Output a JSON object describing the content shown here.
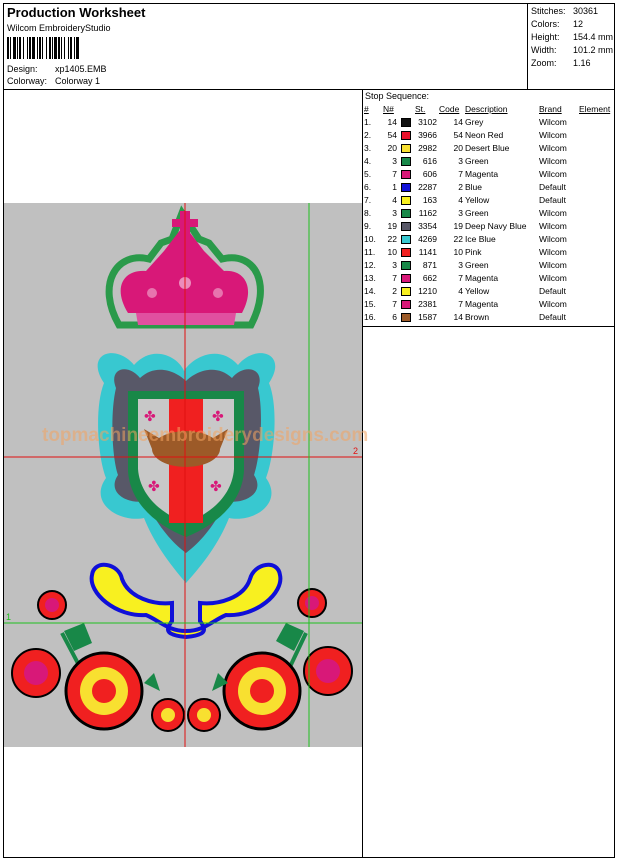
{
  "header": {
    "title": "Production Worksheet",
    "software": "Wilcom EmbroideryStudio",
    "design_label": "Design:",
    "design_value": "xp1405.EMB",
    "colorway_label": "Colorway:",
    "colorway_value": "Colorway 1"
  },
  "stats": {
    "stitches_label": "Stitches:",
    "stitches_value": "30361",
    "colors_label": "Colors:",
    "colors_value": "12",
    "height_label": "Height:",
    "height_value": "154.4 mm",
    "width_label": "Width:",
    "width_value": "101.2 mm",
    "zoom_label": "Zoom:",
    "zoom_value": "1.16"
  },
  "preview": {
    "watermark": "topmachineembroiderydesigns.com",
    "marker_1": "1",
    "marker_2": "2"
  },
  "sequence": {
    "title": "Stop Sequence:",
    "headers": {
      "idx": "#",
      "n": "N#",
      "st": "St.",
      "code": "Code",
      "desc": "Description",
      "brand": "Brand",
      "element": "Element"
    },
    "rows": [
      {
        "idx": "1.",
        "n": "14",
        "color": "#101010",
        "st": "3102",
        "code": "14",
        "desc": "Grey",
        "brand": "Wilcom"
      },
      {
        "idx": "2.",
        "n": "54",
        "color": "#e8102a",
        "st": "3966",
        "code": "54",
        "desc": "Neon Red",
        "brand": "Wilcom"
      },
      {
        "idx": "3.",
        "n": "20",
        "color": "#f8e030",
        "st": "2982",
        "code": "20",
        "desc": "Desert Blue",
        "brand": "Wilcom"
      },
      {
        "idx": "4.",
        "n": "3",
        "color": "#188848",
        "st": "616",
        "code": "3",
        "desc": "Green",
        "brand": "Wilcom"
      },
      {
        "idx": "5.",
        "n": "7",
        "color": "#d81878",
        "st": "606",
        "code": "7",
        "desc": "Magenta",
        "brand": "Wilcom"
      },
      {
        "idx": "6.",
        "n": "1",
        "color": "#1010d8",
        "st": "2287",
        "code": "2",
        "desc": "Blue",
        "brand": "Default"
      },
      {
        "idx": "7.",
        "n": "4",
        "color": "#f8f020",
        "st": "163",
        "code": "4",
        "desc": "Yellow",
        "brand": "Default"
      },
      {
        "idx": "8.",
        "n": "3",
        "color": "#188848",
        "st": "1162",
        "code": "3",
        "desc": "Green",
        "brand": "Wilcom"
      },
      {
        "idx": "9.",
        "n": "19",
        "color": "#585868",
        "st": "3354",
        "code": "19",
        "desc": "Deep Navy Blue",
        "brand": "Wilcom"
      },
      {
        "idx": "10.",
        "n": "22",
        "color": "#38c8d0",
        "st": "4269",
        "code": "22",
        "desc": "Ice Blue",
        "brand": "Wilcom"
      },
      {
        "idx": "11.",
        "n": "10",
        "color": "#f02020",
        "st": "1141",
        "code": "10",
        "desc": "Pink",
        "brand": "Wilcom"
      },
      {
        "idx": "12.",
        "n": "3",
        "color": "#188848",
        "st": "871",
        "code": "3",
        "desc": "Green",
        "brand": "Wilcom"
      },
      {
        "idx": "13.",
        "n": "7",
        "color": "#d81878",
        "st": "662",
        "code": "7",
        "desc": "Magenta",
        "brand": "Wilcom"
      },
      {
        "idx": "14.",
        "n": "2",
        "color": "#f8f020",
        "st": "1210",
        "code": "4",
        "desc": "Yellow",
        "brand": "Default"
      },
      {
        "idx": "15.",
        "n": "7",
        "color": "#d81878",
        "st": "2381",
        "code": "7",
        "desc": "Magenta",
        "brand": "Wilcom"
      },
      {
        "idx": "16.",
        "n": "6",
        "color": "#9c5a28",
        "st": "1587",
        "code": "14",
        "desc": "Brown",
        "brand": "Default"
      }
    ]
  }
}
